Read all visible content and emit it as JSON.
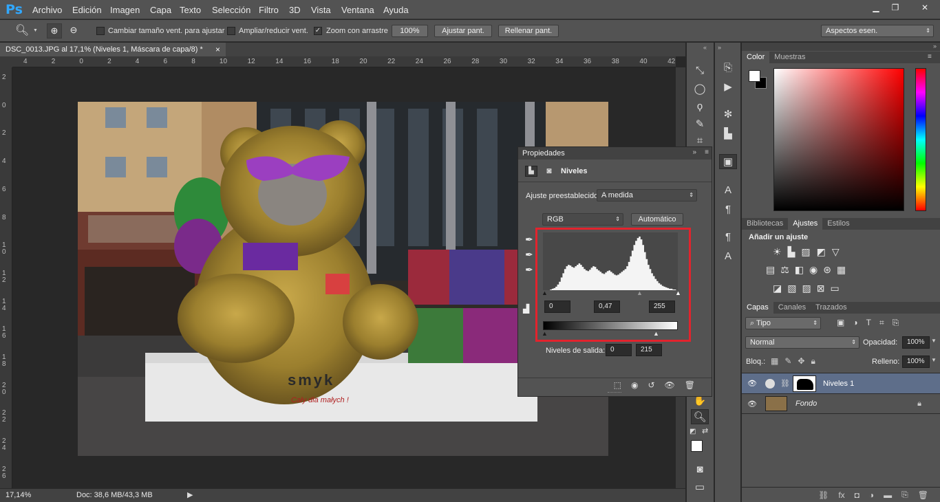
{
  "app": {
    "logo": "Ps"
  },
  "menu": [
    "Archivo",
    "Edición",
    "Imagen",
    "Capa",
    "Texto",
    "Selección",
    "Filtro",
    "3D",
    "Vista",
    "Ventana",
    "Ayuda"
  ],
  "options": {
    "resize_label": "Cambiar tamaño vent. para ajustar",
    "zoom_all_label": "Ampliar/reducir vent.",
    "scrubby_label": "Zoom con arrastre",
    "zoom_value": "100%",
    "fit_label": "Ajustar pant.",
    "fill_label": "Rellenar pant.",
    "workspace": "Aspectos esen."
  },
  "document": {
    "tab": "DSC_0013.JPG al 17,1% (Niveles 1, Máscara de capa/8) *",
    "close": "×"
  },
  "ruler_top": [
    "4",
    "2",
    "0",
    "2",
    "4",
    "6",
    "8",
    "10",
    "12",
    "14",
    "16",
    "18",
    "20",
    "22",
    "24",
    "26",
    "28",
    "30",
    "32",
    "34",
    "36",
    "38",
    "40",
    "42"
  ],
  "ruler_left": [
    "2",
    "0",
    "2",
    "4",
    "6",
    "8",
    "1 0",
    "1 2",
    "1 4",
    "1 6",
    "1 8",
    "2 0",
    "2 2",
    "2 4",
    "2 6"
  ],
  "status": {
    "zoom": "17,14%",
    "doc": "Doc: 38,6 MB/43,3 MB"
  },
  "properties": {
    "title": "Propiedades",
    "adj_name": "Niveles",
    "preset_label": "Ajuste preestablecido:",
    "preset_value": "A medida",
    "channel": "RGB",
    "auto": "Automático",
    "input_black": "0",
    "input_gamma": "0,47",
    "input_white": "255",
    "output_label": "Niveles de salida:",
    "output_black": "0",
    "output_white": "215",
    "histogram": [
      0,
      0,
      0,
      0,
      1,
      2,
      3,
      5,
      8,
      12,
      18,
      24,
      30,
      34,
      36,
      35,
      33,
      32,
      34,
      36,
      38,
      36,
      33,
      30,
      28,
      27,
      29,
      32,
      34,
      33,
      30,
      28,
      26,
      24,
      23,
      25,
      27,
      28,
      26,
      24,
      22,
      21,
      22,
      24,
      26,
      28,
      30,
      34,
      40,
      48,
      56,
      64,
      70,
      74,
      76,
      72,
      64,
      54,
      44,
      36,
      30,
      24,
      20,
      16,
      13,
      10,
      8,
      6,
      5,
      4,
      3,
      2,
      2,
      1,
      1,
      0
    ]
  },
  "color_panel": {
    "tabs": [
      "Color",
      "Muestras"
    ]
  },
  "adjust_panel": {
    "tabs": [
      "Bibliotecas",
      "Ajustes",
      "Estilos"
    ],
    "title": "Añadir un ajuste"
  },
  "layers_panel": {
    "tabs": [
      "Capas",
      "Canales",
      "Trazados"
    ],
    "filter": "Tipo",
    "blend": "Normal",
    "opacity_label": "Opacidad:",
    "opacity": "100%",
    "lock_label": "Bloq.:",
    "fill_label": "Relleno:",
    "fill": "100%",
    "layers": [
      {
        "name": "Niveles 1",
        "selected": true
      },
      {
        "name": "Fondo",
        "selected": false
      }
    ]
  },
  "photo_text": {
    "logo": "smyk",
    "slogan": "Cały dla małych !"
  },
  "colors": {
    "accent_red": "#e3232d",
    "ps_blue": "#31a8ff",
    "layer_selected": "#5e6e8a"
  }
}
